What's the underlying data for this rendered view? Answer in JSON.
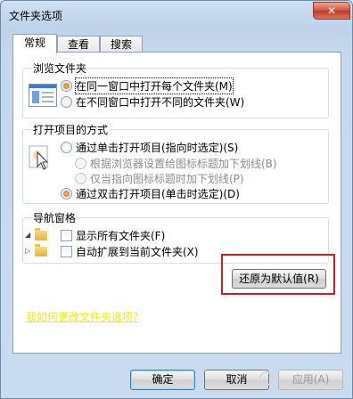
{
  "window": {
    "title": "文件夹选项",
    "close_glyph": "✕"
  },
  "tabs": [
    {
      "label": "常规",
      "active": true
    },
    {
      "label": "查看",
      "active": false
    },
    {
      "label": "搜索",
      "active": false
    }
  ],
  "browse": {
    "title": "浏览文件夹",
    "options": [
      {
        "label": "在同一窗口中打开每个文件夹(M)",
        "checked": true
      },
      {
        "label": "在不同窗口中打开不同的文件夹(W)",
        "checked": false
      }
    ]
  },
  "click": {
    "title": "打开项目的方式",
    "options": [
      {
        "label": "通过单击打开项目(指向时选定)(S)",
        "checked": false
      },
      {
        "label": "根据浏览器设置给图标标题加下划线(B)",
        "checked": false
      },
      {
        "label": "仅当指向图标标题时加下划线(P)",
        "checked": false
      },
      {
        "label": "通过双击打开项目(单击时选定)(D)",
        "checked": true
      }
    ]
  },
  "nav": {
    "title": "导航窗格",
    "checks": [
      {
        "label": "显示所有文件夹(F)",
        "checked": false
      },
      {
        "label": "自动扩展到当前文件夹(X)",
        "checked": false
      }
    ]
  },
  "restore_button": "还原为默认值(R)",
  "help_link": "我如何更改文件夹选项?",
  "buttons": {
    "ok": "确定",
    "cancel": "取消",
    "apply": "应用(A)"
  },
  "colors": {
    "highlight": "#d6182c",
    "link": "#f2e81b"
  }
}
